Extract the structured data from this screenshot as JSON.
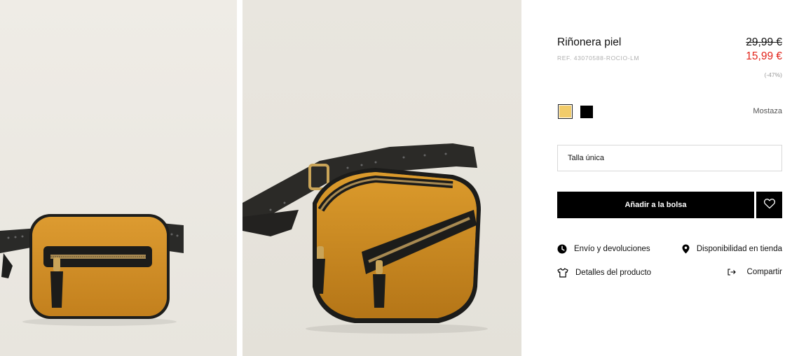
{
  "product": {
    "title": "Riñonera piel",
    "ref": "REF. 43070588-ROCIO-LM",
    "price_old": "29,99 €",
    "price_new": "15,99 €",
    "discount": "(-47%)"
  },
  "colors": {
    "selected_name": "Mostaza",
    "swatches": [
      {
        "name": "Mostaza",
        "hex": "#f2cc6a"
      },
      {
        "name": "Negro",
        "hex": "#000000"
      }
    ]
  },
  "size": {
    "selected": "Talla única"
  },
  "actions": {
    "add_to_bag": "Añadir a la bolsa",
    "favorite_icon": "heart-icon"
  },
  "links": {
    "shipping": "Envío y devoluciones",
    "availability": "Disponibilidad en tienda",
    "details": "Detalles del producto",
    "share": "Compartir"
  },
  "theme": {
    "accent_red": "#e2231a",
    "bag_mustard": "#d38f22",
    "background": "#ffffff"
  }
}
